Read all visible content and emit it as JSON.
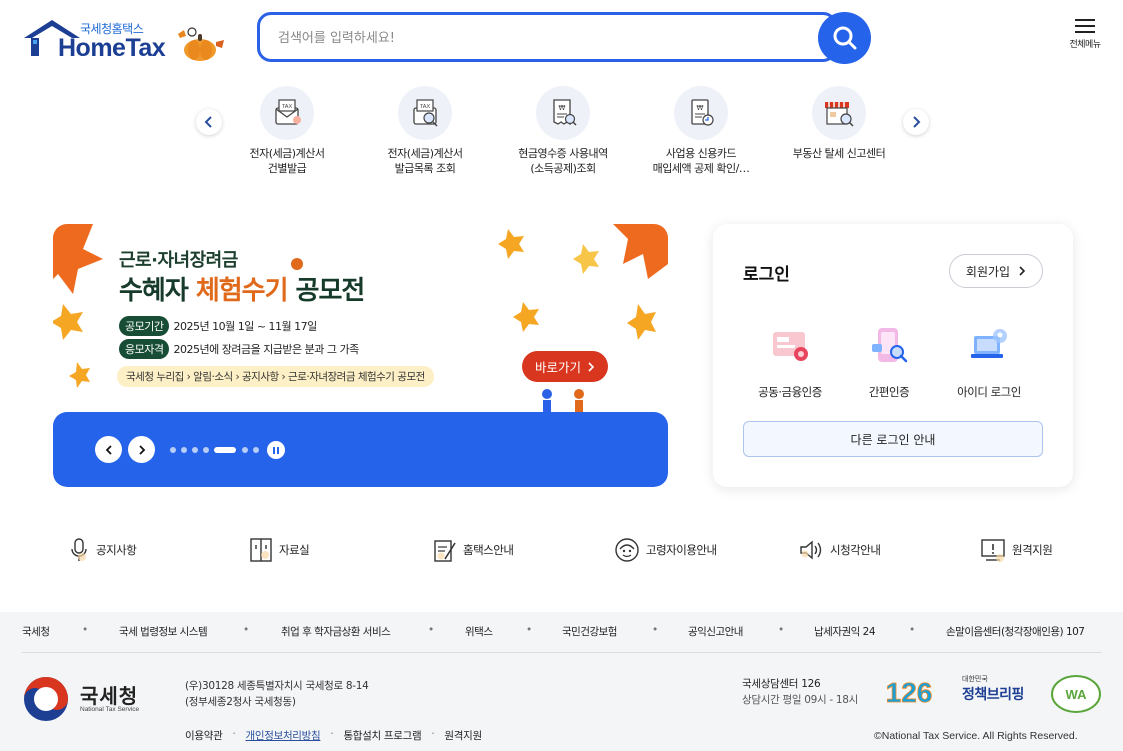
{
  "header": {
    "brand_sub": "국세청홈택스",
    "brand_main": "HomeTax",
    "search_placeholder": "검색어를 입력하세요!",
    "menu_label": "전체메뉴"
  },
  "quick_services": [
    {
      "label": "전자(세금)계산서\n건별발급",
      "icon": "tax-invoice-envelope-icon"
    },
    {
      "label": "전자(세금)계산서\n발급목록 조회",
      "icon": "tax-invoice-search-icon"
    },
    {
      "label": "현금영수증 사용내역\n(소득공제)조회",
      "icon": "cash-receipt-search-icon"
    },
    {
      "label": "사업용 신용카드\n매입세액 공제 확인/…",
      "icon": "credit-card-document-icon"
    },
    {
      "label": "부동산 탈세 신고센터",
      "icon": "store-search-icon"
    }
  ],
  "banner": {
    "title1": "근로·자녀장려금",
    "title2_a": "수혜자 ",
    "title2_b": "체험수기",
    "title2_c": " 공모전",
    "period_tag": "공모기간",
    "period_text": "2025년 10월 1일 ~ 11월 17일",
    "eligibility_tag": "응모자격",
    "eligibility_text": "2025년에 장려금을 지급받은 분과 그 가족",
    "breadcrumb": "국세청 누리집 › 알림·소식 › 공지사항 › 근로·자녀장려금 체험수기 공모전",
    "go_label": "바로가기",
    "slide_count": 7,
    "active_slide": 4
  },
  "login": {
    "title": "로그인",
    "signup_label": "회원가입",
    "options": [
      {
        "label": "공동·금융인증",
        "icon": "certificate-icon"
      },
      {
        "label": "간편인증",
        "icon": "simple-auth-phone-icon"
      },
      {
        "label": "아이디 로그인",
        "icon": "id-login-laptop-icon"
      }
    ],
    "other_label": "다른 로그인 안내"
  },
  "shortcuts": [
    {
      "label": "공지사항",
      "icon": "microphone-icon"
    },
    {
      "label": "자료실",
      "icon": "cabinet-icon"
    },
    {
      "label": "홈택스안내",
      "icon": "guide-edit-icon"
    },
    {
      "label": "고령자이용안내",
      "icon": "elderly-icon"
    },
    {
      "label": "시청각안내",
      "icon": "speaker-icon"
    },
    {
      "label": "원격지원",
      "icon": "remote-monitor-icon"
    }
  ],
  "footer": {
    "links": [
      "국세청",
      "국세 법령정보 시스템",
      "취업 후 학자금상환 서비스",
      "위택스",
      "국민건강보험",
      "공익신고안내",
      "납세자권익 24",
      "손말이음센터(청각장애인용) 107"
    ],
    "org_name": "국세청",
    "org_name_en": "National Tax Service",
    "address_line1": "(우)30128 세종특별자치시 국세청로 8-14",
    "address_line2": "(정부세종2청사 국세청동)",
    "nav": [
      "이용약관",
      "개인정보처리방침",
      "통합설치 프로그램",
      "원격지원"
    ],
    "call_center": "국세상담센터 126",
    "call_hours": "상담시간 평일 09시 - 18시",
    "badge_126": "126",
    "badge_policy_small": "대한민국",
    "badge_policy": "정책브리핑",
    "badge_wa": "WA",
    "copyright": "©National Tax Service. All Rights Reserved.",
    "accent": "#2563eb"
  }
}
